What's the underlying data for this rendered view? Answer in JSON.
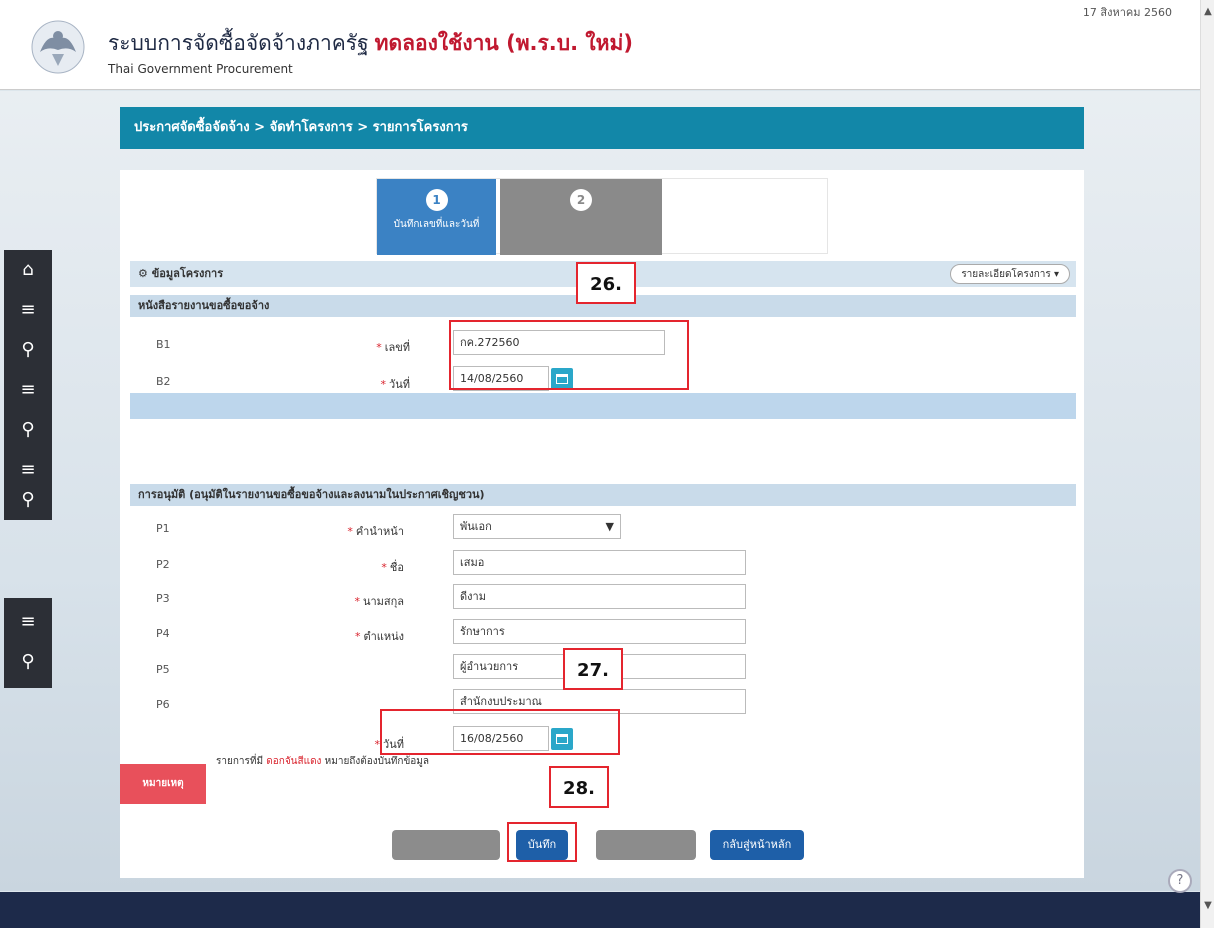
{
  "header": {
    "title": "ระบบการจัดซื้อจัดจ้างภาครัฐ",
    "title_trial": "ทดลองใช้งาน (พ.ร.บ. ใหม่)",
    "subtitle": "Thai Government Procurement",
    "user_date": "17 สิงหาคม 2560"
  },
  "breadcrumb": "ประกาศจัดซื้อจัดจ้าง > จัดทำโครงการ > รายการโครงการ",
  "steps": [
    {
      "num": "1",
      "label": "บันทึกเลขที่และวันที่"
    },
    {
      "num": "2",
      "label": ""
    }
  ],
  "project": {
    "title": "ข้อมูลโครงการ",
    "details_dropdown": "รายละเอียดโครงการ ▾"
  },
  "memo_section": {
    "title": "หนังสือรายงานขอซื้อขอจ้าง",
    "rows": [
      {
        "code": "B1",
        "label": "เลขที่",
        "value": "กค.272560"
      },
      {
        "code": "B2",
        "label": "วันที่",
        "value": "14/08/2560",
        "hint": ""
      }
    ]
  },
  "approval_section": {
    "title": "การอนุมัติ (อนุมัติในรายงานขอซื้อขอจ้างและลงนามในประกาศเชิญชวน)",
    "rows": [
      {
        "code": "P1",
        "label": "คำนำหน้า",
        "value": "พันเอก",
        "required": true,
        "type": "select"
      },
      {
        "code": "P2",
        "label": "ชื่อ",
        "value": "เสมอ",
        "required": true
      },
      {
        "code": "P3",
        "label": "นามสกุล",
        "value": "ดีงาม",
        "required": true
      },
      {
        "code": "P4",
        "label": "ตำแหน่ง",
        "value": "รักษาการ",
        "required": true
      },
      {
        "code": "P5",
        "label": "",
        "value": "ผู้อำนวยการ",
        "required": false
      },
      {
        "code": "P6",
        "label": "",
        "value": "สำนักงบประมาณ",
        "required": false
      }
    ],
    "date_row": {
      "label": "วันที่",
      "value": "16/08/2560",
      "hint": ""
    }
  },
  "note": {
    "badge": "หมายเหตุ",
    "text_before": "รายการที่มี",
    "text_red": "ดอกจันสีแดง",
    "text_after": "หมายถึงต้องบันทึกข้อมูล"
  },
  "buttons": {
    "btn1": "",
    "save": "บันทึก",
    "btn3": "",
    "back_home": "กลับสู่หน้าหลัก"
  },
  "annotations": {
    "c26": "26.",
    "c27": "27.",
    "c28": "28."
  },
  "footer": {
    "text": "",
    "code": ""
  },
  "colors": {
    "accent": "#1287a8",
    "step_active": "#3b82c4",
    "step_inactive": "#8a8a8a",
    "required": "#d9232d",
    "annotation": "#e4252e",
    "save_button": "#1e5fa8"
  }
}
